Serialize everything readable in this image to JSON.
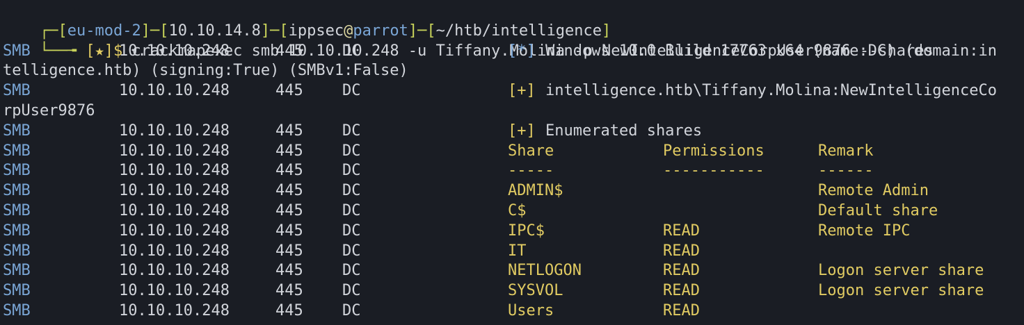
{
  "prompt": {
    "open": "┌─",
    "context": "eu-mod-2",
    "ip": "10.10.14.8",
    "user": "ippsec",
    "at": "@",
    "host": "parrot",
    "cwd": "~/htb/intelligence",
    "line2_prefix": "└──╼ ",
    "star": "[★]$",
    "command": "crackmapexec smb 10.10.10.248 -u Tiffany.Molina -p NewIntelligenceCorpUser9876 --shares"
  },
  "proto": "SMB",
  "host_ip": "10.10.10.248",
  "port": "445",
  "hostname": "DC",
  "messages": {
    "info_tag": "[*]",
    "info_text": "Windows 10.0 Build 17763 x64 (name:DC) (domain:in",
    "info_wrap": "telligence.htb) (signing:True) (SMBv1:False)",
    "plus_tag": "[+]",
    "auth_text": "intelligence.htb\\Tiffany.Molina:NewIntelligenceCo",
    "auth_wrap": "rpUser9876",
    "enum_text": "Enumerated shares"
  },
  "table": {
    "headers": [
      "Share",
      "Permissions",
      "Remark"
    ],
    "dividers": [
      "-----",
      "-----------",
      "------"
    ],
    "rows": [
      {
        "share": "ADMIN$",
        "perm": "",
        "remark": "Remote Admin"
      },
      {
        "share": "C$",
        "perm": "",
        "remark": "Default share"
      },
      {
        "share": "IPC$",
        "perm": "READ",
        "remark": "Remote IPC"
      },
      {
        "share": "IT",
        "perm": "READ",
        "remark": ""
      },
      {
        "share": "NETLOGON",
        "perm": "READ",
        "remark": "Logon server share"
      },
      {
        "share": "SYSVOL",
        "perm": "READ",
        "remark": "Logon server share"
      },
      {
        "share": "Users",
        "perm": "READ",
        "remark": ""
      }
    ]
  },
  "colors": {
    "background": "#1a1d24",
    "prompt_frame": "#c8d35a",
    "blue": "#7aa6d6",
    "yellow": "#e1cb62",
    "text": "#d2d5db"
  }
}
